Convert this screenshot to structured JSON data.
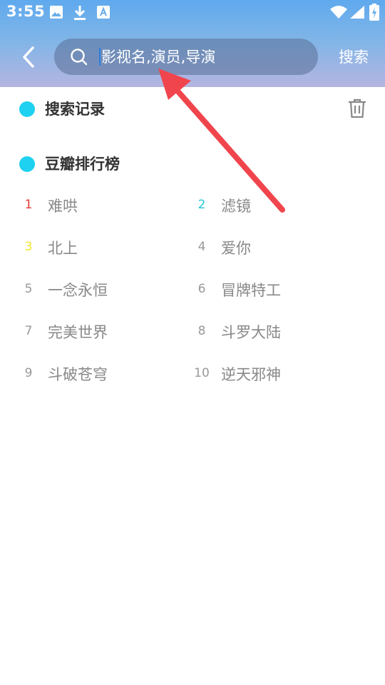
{
  "status_bar": {
    "time": "3:55"
  },
  "header": {
    "search_placeholder": "影视名,演员,导演",
    "search_button": "搜索"
  },
  "history": {
    "title": "搜索记录"
  },
  "ranking": {
    "title": "豆瓣排行榜",
    "items": [
      {
        "rank": "1",
        "title": "难哄",
        "color": "#e53935"
      },
      {
        "rank": "2",
        "title": "滤镜",
        "color": "#26c6da"
      },
      {
        "rank": "3",
        "title": "北上",
        "color": "#f2e52a"
      },
      {
        "rank": "4",
        "title": "爱你",
        "color": "#999999"
      },
      {
        "rank": "5",
        "title": "一念永恒",
        "color": "#999999"
      },
      {
        "rank": "6",
        "title": "冒牌特工",
        "color": "#999999"
      },
      {
        "rank": "7",
        "title": "完美世界",
        "color": "#999999"
      },
      {
        "rank": "8",
        "title": "斗罗大陆",
        "color": "#999999"
      },
      {
        "rank": "9",
        "title": "斗破苍穹",
        "color": "#999999"
      },
      {
        "rank": "10",
        "title": "逆天邪神",
        "color": "#999999"
      }
    ]
  },
  "colors": {
    "accent_dot": "#1fd1f0",
    "annotation_arrow": "#f0454d"
  }
}
